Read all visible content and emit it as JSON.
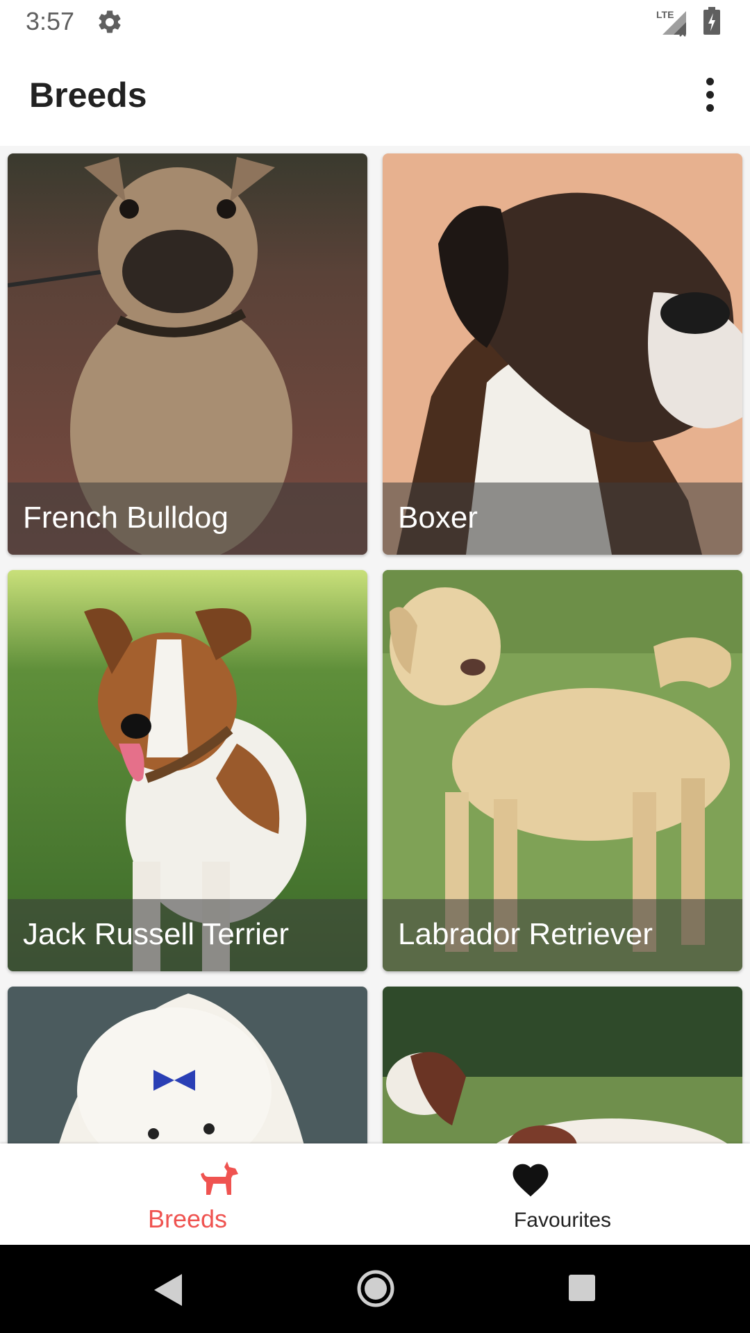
{
  "status_bar": {
    "time": "3:57",
    "network_label": "LTE",
    "icons": [
      "gear-icon",
      "signal-icon",
      "battery-charging-icon"
    ]
  },
  "app_bar": {
    "title": "Breeds",
    "menu_icon": "more-vert-icon"
  },
  "breeds": [
    {
      "name": "French Bulldog"
    },
    {
      "name": "Boxer"
    },
    {
      "name": "Jack Russell Terrier"
    },
    {
      "name": "Labrador Retriever"
    },
    {
      "name": ""
    },
    {
      "name": ""
    }
  ],
  "bottom_nav": {
    "items": [
      {
        "label": "Breeds",
        "icon": "dog-icon",
        "selected": true
      },
      {
        "label": "Favourites",
        "icon": "heart-icon",
        "selected": false
      }
    ],
    "active_color": "#ef5350"
  },
  "system_nav": {
    "icons": [
      "back-icon",
      "home-icon",
      "recents-icon"
    ]
  }
}
